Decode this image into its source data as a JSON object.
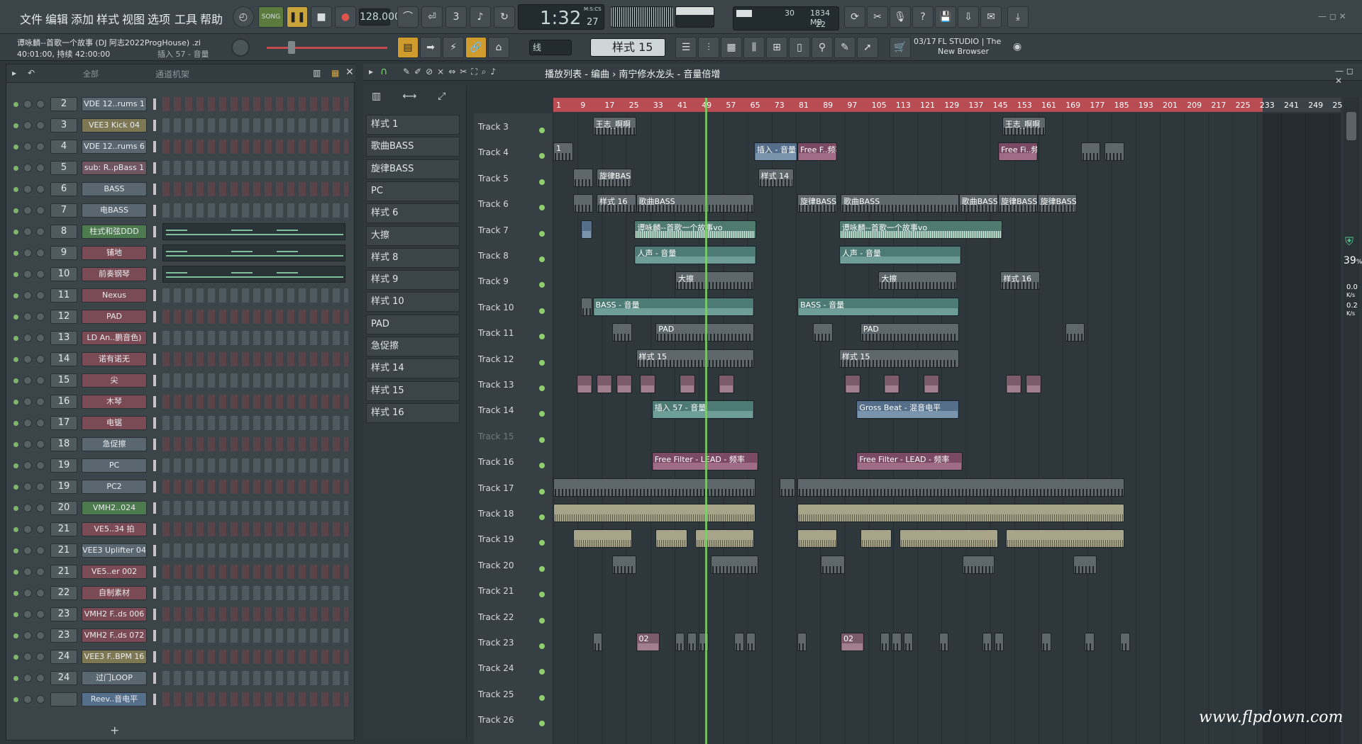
{
  "menu": [
    "文件",
    "编辑",
    "添加",
    "样式",
    "视图",
    "选项",
    "工具",
    "帮助"
  ],
  "transport": {
    "song_label": "SONG",
    "tempo": "128.000",
    "time": "1:32",
    "time_sub": "27",
    "time_unit": "M:S:CS",
    "cpu": "30",
    "ram": "1834 MB",
    "poly": "22"
  },
  "project": {
    "title": "谭咏麟--首歌一个故事 (DJ 阿志2022ProgHouse) .zi",
    "sub1": "40:01:00, 持续 42:00:00",
    "sub2": "插入 57 - 音量"
  },
  "snap": "线",
  "pattern_selector": "样式 15",
  "news": {
    "date": "03/17",
    "text": "FL STUDIO | The New Browser"
  },
  "rack": {
    "filter": "全部",
    "title": "通道机架",
    "add": "+"
  },
  "channels": [
    {
      "num": "2",
      "name": "VDE 12..rums 1",
      "color": "#5b6770",
      "kind": "steps"
    },
    {
      "num": "3",
      "name": "VEE3 Kick 04",
      "color": "#7d7754",
      "kind": "steps"
    },
    {
      "num": "4",
      "name": "VDE 12..rums 6",
      "color": "#5b6770",
      "kind": "steps"
    },
    {
      "num": "5",
      "name": "sub: R..pBass 1",
      "color": "#6f5560",
      "kind": "steps"
    },
    {
      "num": "6",
      "name": "BASS",
      "color": "#5b6770",
      "kind": "steps"
    },
    {
      "num": "7",
      "name": "电BASS",
      "color": "#5b6770",
      "kind": "steps"
    },
    {
      "num": "8",
      "name": "柱式和弦DDD",
      "color": "#4d7a4e",
      "kind": "roll"
    },
    {
      "num": "9",
      "name": "铺地",
      "color": "#7a4a55",
      "kind": "roll"
    },
    {
      "num": "10",
      "name": "前奏钢琴",
      "color": "#7a4a55",
      "kind": "roll"
    },
    {
      "num": "11",
      "name": "Nexus",
      "color": "#7a4a55",
      "kind": "steps"
    },
    {
      "num": "12",
      "name": "PAD",
      "color": "#7a4a55",
      "kind": "steps"
    },
    {
      "num": "13",
      "name": "LD An..鹏音色)",
      "color": "#7a4a55",
      "kind": "steps"
    },
    {
      "num": "14",
      "name": "诺有诺无",
      "color": "#7a4a55",
      "kind": "steps"
    },
    {
      "num": "15",
      "name": "尖",
      "color": "#7a4a55",
      "kind": "steps"
    },
    {
      "num": "16",
      "name": "木琴",
      "color": "#7a4a55",
      "kind": "steps"
    },
    {
      "num": "17",
      "name": "电锯",
      "color": "#7a4a55",
      "kind": "steps"
    },
    {
      "num": "18",
      "name": "急促擦",
      "color": "#5b6770",
      "kind": "steps"
    },
    {
      "num": "19",
      "name": "PC",
      "color": "#5b6770",
      "kind": "steps"
    },
    {
      "num": "19",
      "name": "PC2",
      "color": "#5b6770",
      "kind": "steps"
    },
    {
      "num": "20",
      "name": "VMH2..024",
      "color": "#4d7a4e",
      "kind": "steps"
    },
    {
      "num": "21",
      "name": "VE5..34 拍",
      "color": "#7a4a55",
      "kind": "steps"
    },
    {
      "num": "21",
      "name": "VEE3 Uplifter 04",
      "color": "#5b6770",
      "kind": "steps"
    },
    {
      "num": "21",
      "name": "VE5..er 002",
      "color": "#7a4a55",
      "kind": "steps"
    },
    {
      "num": "22",
      "name": "自制素材",
      "color": "#7a4a55",
      "kind": "steps"
    },
    {
      "num": "23",
      "name": "VMH2 F..ds 006",
      "color": "#7a4a55",
      "kind": "steps"
    },
    {
      "num": "23",
      "name": "VMH2 F..ds 072",
      "color": "#7a4a55",
      "kind": "steps"
    },
    {
      "num": "24",
      "name": "VEE3 F..BPM 16",
      "color": "#7d7754",
      "kind": "steps"
    },
    {
      "num": "24",
      "name": "过门LOOP",
      "color": "#5b6770",
      "kind": "steps"
    },
    {
      "num": "",
      "name": "Reev..音电平",
      "color": "#556e8a",
      "kind": "steps"
    }
  ],
  "breadcrumb": "播放列表 - 编曲 › 南宁修水龙头 - 音量倍增",
  "patterns": [
    "样式 1",
    "歌曲BASS",
    "旋律BASS",
    "PC",
    "样式 6",
    "大擦",
    "样式 8",
    "样式 9",
    "样式 10",
    "PAD",
    "急促擦",
    "样式 14",
    "样式 15",
    "样式 16"
  ],
  "ruler": [
    "1",
    "9",
    "17",
    "25",
    "33",
    "41",
    "49",
    "57",
    "65",
    "73",
    "81",
    "89",
    "97",
    "105",
    "113",
    "121",
    "129",
    "137",
    "145",
    "153",
    "161",
    "169",
    "177",
    "185",
    "193",
    "201",
    "209",
    "217",
    "225",
    "233",
    "241",
    "249",
    "25"
  ],
  "tracks": [
    "Track 3",
    "Track 4",
    "Track 5",
    "Track 6",
    "Track 7",
    "Track 8",
    "Track 9",
    "Track 10",
    "Track 11",
    "Track 12",
    "Track 13",
    "Track 14",
    "Track 15",
    "Track 16",
    "Track 17",
    "Track 18",
    "Track 19",
    "Track 20",
    "Track 21",
    "Track 22",
    "Track 23",
    "Track 24",
    "Track 25",
    "Track 26"
  ],
  "clips": [
    {
      "t": 0,
      "x": 0.05,
      "w": 0.055,
      "c": "gray",
      "label": "王志_啊啊"
    },
    {
      "t": 0,
      "x": 0.57,
      "w": 0.055,
      "c": "gray",
      "label": "王志_啊啊"
    },
    {
      "t": 1,
      "x": 0.0,
      "w": 0.025,
      "c": "gray",
      "label": "1"
    },
    {
      "t": 1,
      "x": 0.255,
      "w": 0.055,
      "c": "blue",
      "label": "插入 - 音量"
    },
    {
      "t": 1,
      "x": 0.31,
      "w": 0.05,
      "c": "pink",
      "label": "Free F..频率"
    },
    {
      "t": 1,
      "x": 0.565,
      "w": 0.05,
      "c": "pink",
      "label": "Free Fi..频率"
    },
    {
      "t": 1,
      "x": 0.67,
      "w": 0.025,
      "c": "gray",
      "label": ""
    },
    {
      "t": 1,
      "x": 0.7,
      "w": 0.025,
      "c": "gray",
      "label": ""
    },
    {
      "t": 2,
      "x": 0.025,
      "w": 0.025,
      "c": "gray",
      "label": ""
    },
    {
      "t": 2,
      "x": 0.055,
      "w": 0.045,
      "c": "gray",
      "label": "旋律BASS"
    },
    {
      "t": 2,
      "x": 0.26,
      "w": 0.045,
      "c": "gray",
      "label": "样式 14"
    },
    {
      "t": 3,
      "x": 0.025,
      "w": 0.025,
      "c": "gray",
      "label": ""
    },
    {
      "t": 3,
      "x": 0.055,
      "w": 0.05,
      "c": "gray",
      "label": "样式 16"
    },
    {
      "t": 3,
      "x": 0.105,
      "w": 0.15,
      "c": "gray",
      "label": "歌曲BASS"
    },
    {
      "t": 3,
      "x": 0.31,
      "w": 0.05,
      "c": "gray",
      "label": "旋律BASS"
    },
    {
      "t": 3,
      "x": 0.365,
      "w": 0.15,
      "c": "gray",
      "label": "歌曲BASS"
    },
    {
      "t": 3,
      "x": 0.515,
      "w": 0.05,
      "c": "gray",
      "label": "歌曲BASS"
    },
    {
      "t": 3,
      "x": 0.565,
      "w": 0.05,
      "c": "gray",
      "label": "旋律BASS"
    },
    {
      "t": 3,
      "x": 0.615,
      "w": 0.05,
      "c": "gray",
      "label": "旋律BASS"
    },
    {
      "t": 4,
      "x": 0.035,
      "w": 0.015,
      "c": "blue",
      "label": ""
    },
    {
      "t": 4,
      "x": 0.103,
      "w": 0.155,
      "c": "wave",
      "label": "谭咏麟--首歌一个故事vo"
    },
    {
      "t": 4,
      "x": 0.363,
      "w": 0.207,
      "c": "wave",
      "label": "谭咏麟--首歌一个故事vo"
    },
    {
      "t": 5,
      "x": 0.103,
      "w": 0.155,
      "c": "teal",
      "label": "人声 - 音量"
    },
    {
      "t": 5,
      "x": 0.363,
      "w": 0.155,
      "c": "teal",
      "label": "人声 - 音量"
    },
    {
      "t": 6,
      "x": 0.155,
      "w": 0.1,
      "c": "gray",
      "label": "大擦"
    },
    {
      "t": 6,
      "x": 0.413,
      "w": 0.1,
      "c": "gray",
      "label": "大擦"
    },
    {
      "t": 6,
      "x": 0.568,
      "w": 0.05,
      "c": "gray",
      "label": "样式 16"
    },
    {
      "t": 7,
      "x": 0.035,
      "w": 0.015,
      "c": "gray",
      "label": ""
    },
    {
      "t": 7,
      "x": 0.05,
      "w": 0.205,
      "c": "teal",
      "label": "BASS - 音量"
    },
    {
      "t": 7,
      "x": 0.31,
      "w": 0.205,
      "c": "teal",
      "label": "BASS - 音量"
    },
    {
      "t": 8,
      "x": 0.075,
      "w": 0.025,
      "c": "gray",
      "label": ""
    },
    {
      "t": 8,
      "x": 0.13,
      "w": 0.125,
      "c": "gray",
      "label": "PAD"
    },
    {
      "t": 8,
      "x": 0.33,
      "w": 0.025,
      "c": "gray",
      "label": ""
    },
    {
      "t": 8,
      "x": 0.39,
      "w": 0.125,
      "c": "gray",
      "label": "PAD"
    },
    {
      "t": 8,
      "x": 0.65,
      "w": 0.025,
      "c": "gray",
      "label": ""
    },
    {
      "t": 9,
      "x": 0.105,
      "w": 0.15,
      "c": "gray",
      "label": "样式 15"
    },
    {
      "t": 9,
      "x": 0.363,
      "w": 0.152,
      "c": "gray",
      "label": "样式 15"
    },
    {
      "t": 10,
      "x": 0.03,
      "w": 0.02,
      "c": "mauve",
      "label": ""
    },
    {
      "t": 10,
      "x": 0.055,
      "w": 0.02,
      "c": "mauve",
      "label": ""
    },
    {
      "t": 10,
      "x": 0.08,
      "w": 0.02,
      "c": "mauve",
      "label": ""
    },
    {
      "t": 10,
      "x": 0.11,
      "w": 0.02,
      "c": "mauve",
      "label": ""
    },
    {
      "t": 10,
      "x": 0.16,
      "w": 0.02,
      "c": "mauve",
      "label": ""
    },
    {
      "t": 10,
      "x": 0.21,
      "w": 0.02,
      "c": "mauve",
      "label": ""
    },
    {
      "t": 10,
      "x": 0.37,
      "w": 0.02,
      "c": "mauve",
      "label": ""
    },
    {
      "t": 10,
      "x": 0.42,
      "w": 0.02,
      "c": "mauve",
      "label": ""
    },
    {
      "t": 10,
      "x": 0.47,
      "w": 0.02,
      "c": "mauve",
      "label": ""
    },
    {
      "t": 10,
      "x": 0.575,
      "w": 0.02,
      "c": "mauve",
      "label": ""
    },
    {
      "t": 10,
      "x": 0.6,
      "w": 0.02,
      "c": "mauve",
      "label": ""
    },
    {
      "t": 11,
      "x": 0.125,
      "w": 0.13,
      "c": "teal",
      "label": "插入 57 - 音量"
    },
    {
      "t": 11,
      "x": 0.385,
      "w": 0.13,
      "c": "blue",
      "label": "Gross Beat - 混音电平"
    },
    {
      "t": 13,
      "x": 0.125,
      "w": 0.135,
      "c": "pink",
      "label": "Free Filter - LEAD - 频率"
    },
    {
      "t": 13,
      "x": 0.385,
      "w": 0.135,
      "c": "pink",
      "label": "Free Filter - LEAD - 频率"
    },
    {
      "t": 14,
      "x": 0.0,
      "w": 0.257,
      "c": "gray",
      "label": ""
    },
    {
      "t": 14,
      "x": 0.287,
      "w": 0.02,
      "c": "gray",
      "label": ""
    },
    {
      "t": 14,
      "x": 0.31,
      "w": 0.415,
      "c": "gray",
      "label": ""
    },
    {
      "t": 15,
      "x": 0.0,
      "w": 0.257,
      "c": "sand",
      "label": ""
    },
    {
      "t": 15,
      "x": 0.31,
      "w": 0.415,
      "c": "sand",
      "label": ""
    },
    {
      "t": 16,
      "x": 0.025,
      "w": 0.075,
      "c": "sand",
      "label": ""
    },
    {
      "t": 16,
      "x": 0.13,
      "w": 0.04,
      "c": "sand",
      "label": ""
    },
    {
      "t": 16,
      "x": 0.18,
      "w": 0.075,
      "c": "sand",
      "label": ""
    },
    {
      "t": 16,
      "x": 0.31,
      "w": 0.05,
      "c": "sand",
      "label": ""
    },
    {
      "t": 16,
      "x": 0.39,
      "w": 0.04,
      "c": "sand",
      "label": ""
    },
    {
      "t": 16,
      "x": 0.44,
      "w": 0.125,
      "c": "sand",
      "label": ""
    },
    {
      "t": 16,
      "x": 0.575,
      "w": 0.15,
      "c": "sand",
      "label": ""
    },
    {
      "t": 17,
      "x": 0.075,
      "w": 0.03,
      "c": "gray",
      "label": ""
    },
    {
      "t": 17,
      "x": 0.2,
      "w": 0.06,
      "c": "gray",
      "label": ""
    },
    {
      "t": 17,
      "x": 0.34,
      "w": 0.03,
      "c": "gray",
      "label": ""
    },
    {
      "t": 17,
      "x": 0.52,
      "w": 0.04,
      "c": "gray",
      "label": ""
    },
    {
      "t": 17,
      "x": 0.66,
      "w": 0.03,
      "c": "gray",
      "label": ""
    },
    {
      "t": 20,
      "x": 0.05,
      "w": 0.012,
      "c": "gray",
      "label": ""
    },
    {
      "t": 20,
      "x": 0.105,
      "w": 0.03,
      "c": "mauve",
      "label": "02"
    },
    {
      "t": 20,
      "x": 0.155,
      "w": 0.012,
      "c": "gray",
      "label": ""
    },
    {
      "t": 20,
      "x": 0.17,
      "w": 0.012,
      "c": "gray",
      "label": ""
    },
    {
      "t": 20,
      "x": 0.185,
      "w": 0.012,
      "c": "gray",
      "label": ""
    },
    {
      "t": 20,
      "x": 0.23,
      "w": 0.012,
      "c": "gray",
      "label": ""
    },
    {
      "t": 20,
      "x": 0.245,
      "w": 0.012,
      "c": "gray",
      "label": ""
    },
    {
      "t": 20,
      "x": 0.31,
      "w": 0.012,
      "c": "gray",
      "label": ""
    },
    {
      "t": 20,
      "x": 0.365,
      "w": 0.03,
      "c": "mauve",
      "label": "02"
    },
    {
      "t": 20,
      "x": 0.415,
      "w": 0.012,
      "c": "gray",
      "label": ""
    },
    {
      "t": 20,
      "x": 0.43,
      "w": 0.012,
      "c": "gray",
      "label": ""
    },
    {
      "t": 20,
      "x": 0.445,
      "w": 0.012,
      "c": "gray",
      "label": ""
    },
    {
      "t": 20,
      "x": 0.49,
      "w": 0.012,
      "c": "gray",
      "label": ""
    },
    {
      "t": 20,
      "x": 0.545,
      "w": 0.012,
      "c": "gray",
      "label": ""
    },
    {
      "t": 20,
      "x": 0.56,
      "w": 0.012,
      "c": "gray",
      "label": ""
    },
    {
      "t": 20,
      "x": 0.62,
      "w": 0.012,
      "c": "gray",
      "label": ""
    },
    {
      "t": 20,
      "x": 0.675,
      "w": 0.012,
      "c": "gray",
      "label": ""
    },
    {
      "t": 20,
      "x": 0.72,
      "w": 0.012,
      "c": "gray",
      "label": ""
    }
  ],
  "side": {
    "percent": "39",
    "pct_sign": "%",
    "rate1": "0.0",
    "rate2": "0.2",
    "unit": "K/s"
  },
  "watermark": "www.flpdown.com",
  "timeline_top": "M:S:CS"
}
